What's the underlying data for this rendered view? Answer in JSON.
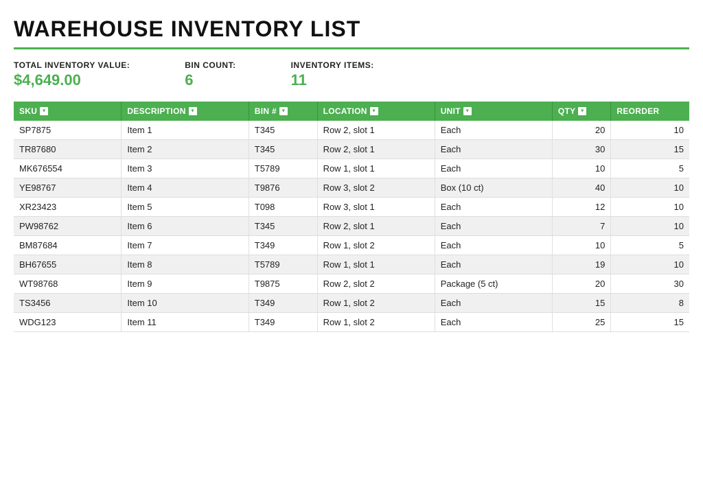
{
  "title": "WAREHOUSE INVENTORY LIST",
  "summary": {
    "total_value_label": "TOTAL INVENTORY VALUE:",
    "total_value": "$4,649.00",
    "bin_count_label": "BIN COUNT:",
    "bin_count": "6",
    "inventory_items_label": "INVENTORY ITEMS:",
    "inventory_items": "11"
  },
  "table": {
    "columns": [
      {
        "key": "sku",
        "label": "SKU",
        "has_filter": true
      },
      {
        "key": "description",
        "label": "DESCRIPTION",
        "has_filter": true
      },
      {
        "key": "bin",
        "label": "BIN #",
        "has_filter": true
      },
      {
        "key": "location",
        "label": "LOCATION",
        "has_filter": true
      },
      {
        "key": "unit",
        "label": "UNIT",
        "has_filter": true
      },
      {
        "key": "qty",
        "label": "QTY",
        "has_filter": true
      },
      {
        "key": "reorder",
        "label": "REORDER",
        "has_filter": false
      }
    ],
    "rows": [
      {
        "sku": "SP7875",
        "description": "Item 1",
        "bin": "T345",
        "location": "Row 2, slot 1",
        "unit": "Each",
        "qty": "20",
        "reorder": "10"
      },
      {
        "sku": "TR87680",
        "description": "Item 2",
        "bin": "T345",
        "location": "Row 2, slot 1",
        "unit": "Each",
        "qty": "30",
        "reorder": "15"
      },
      {
        "sku": "MK676554",
        "description": "Item 3",
        "bin": "T5789",
        "location": "Row 1, slot 1",
        "unit": "Each",
        "qty": "10",
        "reorder": "5"
      },
      {
        "sku": "YE98767",
        "description": "Item 4",
        "bin": "T9876",
        "location": "Row 3, slot 2",
        "unit": "Box (10 ct)",
        "qty": "40",
        "reorder": "10"
      },
      {
        "sku": "XR23423",
        "description": "Item 5",
        "bin": "T098",
        "location": "Row 3, slot 1",
        "unit": "Each",
        "qty": "12",
        "reorder": "10"
      },
      {
        "sku": "PW98762",
        "description": "Item 6",
        "bin": "T345",
        "location": "Row 2, slot 1",
        "unit": "Each",
        "qty": "7",
        "reorder": "10"
      },
      {
        "sku": "BM87684",
        "description": "Item 7",
        "bin": "T349",
        "location": "Row 1, slot 2",
        "unit": "Each",
        "qty": "10",
        "reorder": "5"
      },
      {
        "sku": "BH67655",
        "description": "Item 8",
        "bin": "T5789",
        "location": "Row 1, slot 1",
        "unit": "Each",
        "qty": "19",
        "reorder": "10"
      },
      {
        "sku": "WT98768",
        "description": "Item 9",
        "bin": "T9875",
        "location": "Row 2, slot 2",
        "unit": "Package (5 ct)",
        "qty": "20",
        "reorder": "30"
      },
      {
        "sku": "TS3456",
        "description": "Item 10",
        "bin": "T349",
        "location": "Row 1, slot 2",
        "unit": "Each",
        "qty": "15",
        "reorder": "8"
      },
      {
        "sku": "WDG123",
        "description": "Item 11",
        "bin": "T349",
        "location": "Row 1, slot 2",
        "unit": "Each",
        "qty": "25",
        "reorder": "15"
      }
    ]
  }
}
